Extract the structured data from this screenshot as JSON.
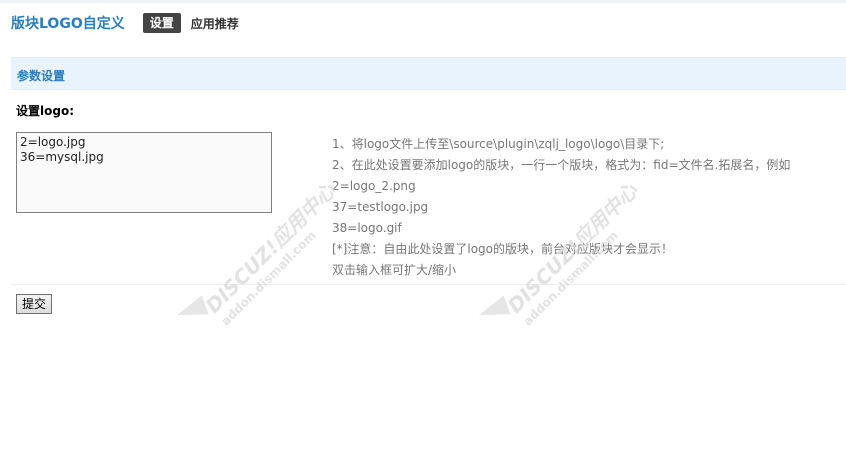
{
  "header": {
    "title": "版块LOGO自定义",
    "tabs": [
      {
        "label": "设置",
        "active": true
      },
      {
        "label": "应用推荐",
        "active": false
      }
    ]
  },
  "section": {
    "title": "参数设置"
  },
  "setting": {
    "label": "设置logo:",
    "textarea_value": "2=logo.jpg\n36=mysql.jpg",
    "tips": [
      "1、将logo文件上传至\\source\\plugin\\zqlj_logo\\logo\\目录下;",
      "2、在此处设置要添加logo的版块，一行一个版块，格式为：fid=文件名.拓展名，例如",
      "2=logo_2.png",
      "37=testlogo.jpg",
      "38=logo.gif",
      "[*]注意：自由此处设置了logo的版块，前台对应版块才会显示！",
      "双击输入框可扩大/缩小"
    ]
  },
  "submit_label": "提交",
  "watermark": {
    "brand": "DISCUZ!应用中心",
    "url": "addon.dismall.com"
  },
  "colors": {
    "accent": "#2b7dbc",
    "section_bg": "#e8f3fd",
    "active_tab_bg": "#444444"
  }
}
